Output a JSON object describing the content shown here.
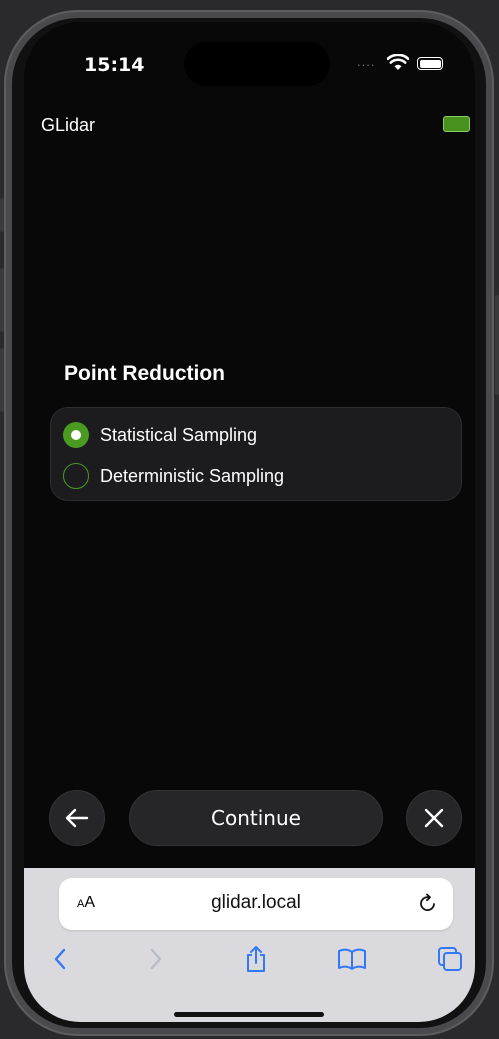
{
  "status_bar": {
    "time": "15:14",
    "signal": "...."
  },
  "app": {
    "title": "GLidar"
  },
  "point_reduction": {
    "title": "Point Reduction",
    "options": [
      {
        "label": "Statistical Sampling",
        "selected": true
      },
      {
        "label": "Deterministic Sampling",
        "selected": false
      }
    ]
  },
  "nav": {
    "continue_label": "Continue"
  },
  "browser": {
    "text_size_small": "A",
    "text_size_large": "A",
    "url": "glidar.local"
  },
  "colors": {
    "accent": "#4a9a22",
    "browser_blue": "#3478f6",
    "background": "#080808"
  }
}
